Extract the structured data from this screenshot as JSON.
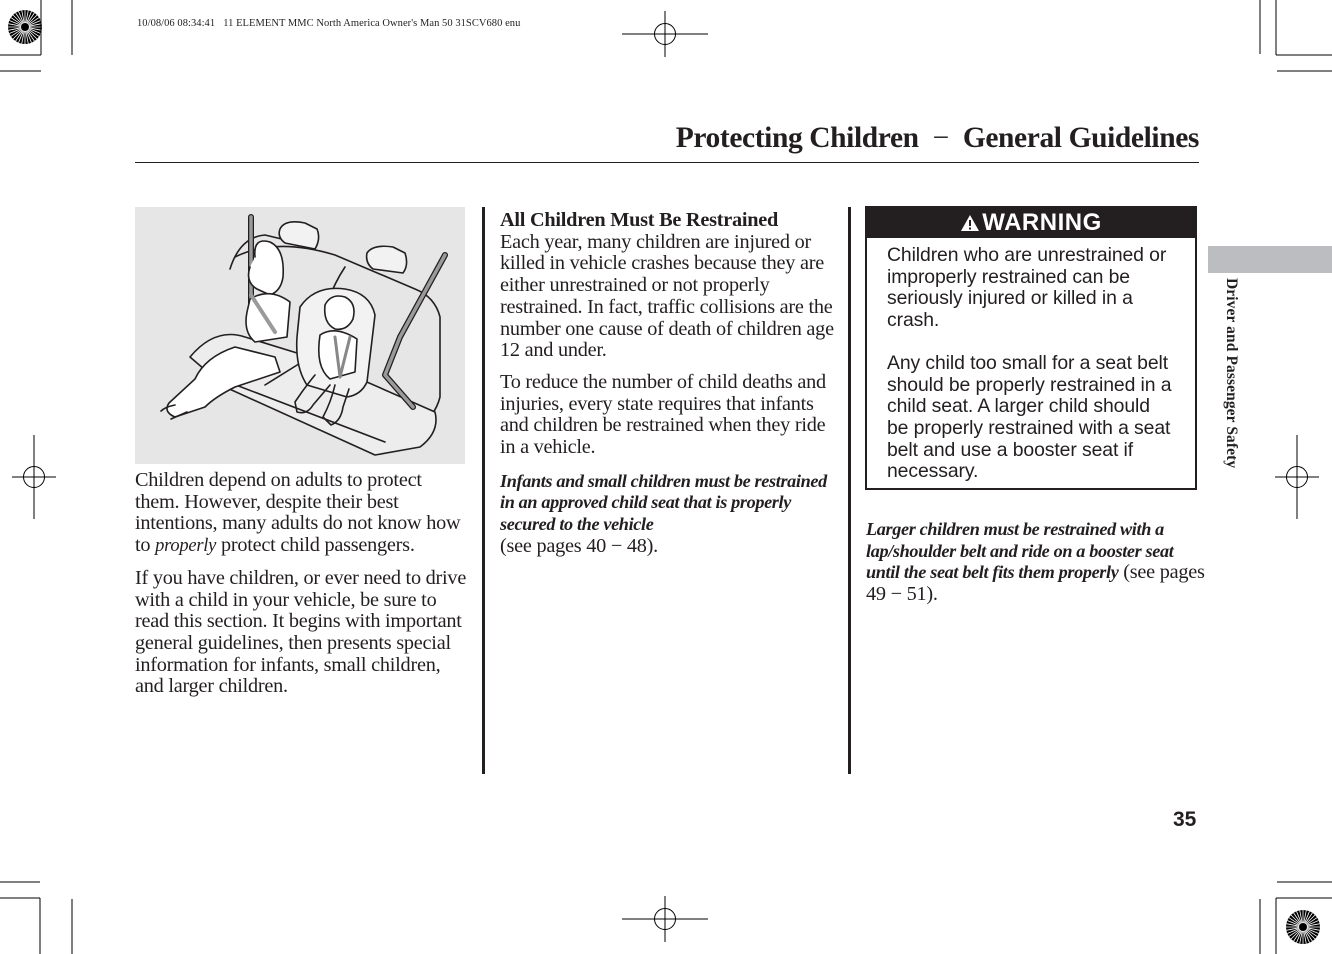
{
  "slug": {
    "timestamp": "10/08/06 08:34:41",
    "job": "11 ELEMENT MMC North America Owner's Man 50 31SCV680 enu"
  },
  "header": {
    "title_left": "Protecting Children",
    "title_sep": "−",
    "title_right": "General Guidelines"
  },
  "side_tab": {
    "label": "Driver and Passenger Safety",
    "color": "#bcbdc0"
  },
  "figure": {
    "description": "Rear seat illustration: older child with lap/shoulder belt and small child in a child seat",
    "background": "#e6e6e6"
  },
  "column1": {
    "p1_a": "Children depend on adults to protect them. However, despite their best intentions, many adults do not know how to ",
    "p1_em": "properly",
    "p1_b": " protect child passengers.",
    "p2": "If you have children, or ever need to drive with a child in your vehicle, be sure to read this section. It begins with important general guidelines, then presents special information for infants, small children, and larger children."
  },
  "column2": {
    "heading": "All Children Must Be Restrained",
    "p1": "Each year, many children are injured or killed in vehicle crashes because they are either unrestrained or not properly restrained. In fact, traffic collisions are the number one cause of death of children age 12 and under.",
    "p2": "To reduce the number of child deaths and injuries, every state requires that infants and children be restrained when they ride in a vehicle.",
    "emphasis": "Infants and small children must be restrained in an approved child seat that is properly secured to the vehicle",
    "ref": "(see pages 40 − 48)."
  },
  "warning": {
    "icon": "warning-triangle-icon",
    "title": "WARNING",
    "p1": "Children who are unrestrained or improperly restrained can be seriously injured or killed in a crash.",
    "p2": "Any child too small for a seat belt should be properly restrained in a child seat. A larger child should be properly restrained with a seat belt and use a booster seat if necessary."
  },
  "column3": {
    "emphasis": "Larger children must be restrained with a lap/shoulder belt and ride on a booster seat until the seat belt fits them properly",
    "ref": " (see pages 49 − 51)."
  },
  "footer": {
    "page_number": "35"
  }
}
